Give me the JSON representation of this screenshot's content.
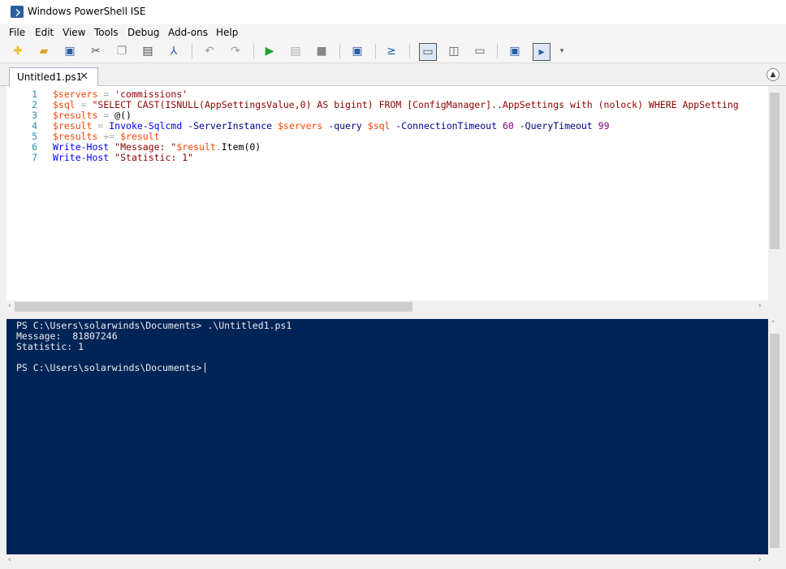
{
  "window": {
    "title": "Windows PowerShell ISE"
  },
  "menu": [
    "File",
    "Edit",
    "View",
    "Tools",
    "Debug",
    "Add-ons",
    "Help"
  ],
  "toolbar_icons": [
    "new-file-icon",
    "open-folder-icon",
    "save-icon",
    "cut-icon",
    "copy-icon",
    "paste-icon",
    "clear-icon",
    "undo-icon",
    "redo-icon",
    "run-icon",
    "run-selection-icon",
    "stop-icon",
    "remote-icon",
    "powershell-icon",
    "script-pane-top-icon",
    "script-pane-right-icon",
    "script-pane-max-icon",
    "show-commands-icon",
    "command-addon-icon"
  ],
  "tab": {
    "label": "Untitled1.ps1",
    "close": "✕"
  },
  "editor": {
    "lines": [
      {
        "num": "1",
        "tokens": [
          {
            "t": "$servers",
            "c": "var"
          },
          {
            "t": " = ",
            "c": "op"
          },
          {
            "t": "'commissions'",
            "c": "str"
          }
        ]
      },
      {
        "num": "2",
        "tokens": [
          {
            "t": "$sql",
            "c": "var"
          },
          {
            "t": " = ",
            "c": "op"
          },
          {
            "t": "\"SELECT CAST(ISNULL(AppSettingsValue,0) AS bigint) FROM [ConfigManager]..AppSettings with (nolock) WHERE AppSetting",
            "c": "str"
          }
        ]
      },
      {
        "num": "3",
        "tokens": [
          {
            "t": "$results",
            "c": "var"
          },
          {
            "t": " = ",
            "c": "op"
          },
          {
            "t": "@()",
            "c": "plain"
          }
        ]
      },
      {
        "num": "4",
        "tokens": [
          {
            "t": "$result",
            "c": "var"
          },
          {
            "t": " = ",
            "c": "op"
          },
          {
            "t": "Invoke-Sqlcmd",
            "c": "cmd"
          },
          {
            "t": " -ServerInstance ",
            "c": "param"
          },
          {
            "t": "$servers",
            "c": "var"
          },
          {
            "t": " -query ",
            "c": "param"
          },
          {
            "t": "$sql",
            "c": "var"
          },
          {
            "t": " -ConnectionTimeout ",
            "c": "param"
          },
          {
            "t": "60",
            "c": "num"
          },
          {
            "t": " -QueryTimeout ",
            "c": "param"
          },
          {
            "t": "99",
            "c": "num"
          }
        ]
      },
      {
        "num": "5",
        "tokens": [
          {
            "t": "$results",
            "c": "var"
          },
          {
            "t": " += ",
            "c": "op"
          },
          {
            "t": "$result",
            "c": "var"
          }
        ]
      },
      {
        "num": "6",
        "tokens": [
          {
            "t": "Write-Host",
            "c": "cmd"
          },
          {
            "t": " \"Message: \"",
            "c": "str"
          },
          {
            "t": "$result",
            "c": "var"
          },
          {
            "t": ".",
            "c": "op"
          },
          {
            "t": "Item",
            "c": "mem"
          },
          {
            "t": "(0)",
            "c": "plain"
          }
        ]
      },
      {
        "num": "7",
        "tokens": [
          {
            "t": "Write-Host",
            "c": "cmd"
          },
          {
            "t": " \"Statistic: 1\"",
            "c": "str"
          }
        ]
      }
    ]
  },
  "console": {
    "lines": [
      "PS C:\\Users\\solarwinds\\Documents> .\\Untitled1.ps1",
      "Message:  81807246",
      "Statistic: 1",
      "",
      "PS C:\\Users\\solarwinds\\Documents>"
    ]
  }
}
